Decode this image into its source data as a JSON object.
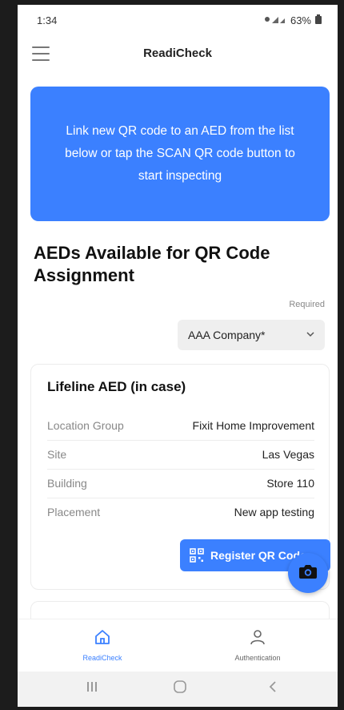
{
  "status_bar": {
    "time": "1:34",
    "battery": "63%"
  },
  "app_bar": {
    "title": "ReadiCheck"
  },
  "banner": {
    "text": "Link new QR code to an AED from the list below or tap the SCAN QR code button to start inspecting"
  },
  "section": {
    "heading": "AEDs Available for QR Code Assignment"
  },
  "company_select": {
    "required_label": "Required",
    "selected": "AAA Company*"
  },
  "aed_card": {
    "title": "Lifeline AED (in case)",
    "rows": [
      {
        "label": "Location Group",
        "value": "Fixit Home Improvement"
      },
      {
        "label": "Site",
        "value": "Las Vegas"
      },
      {
        "label": "Building",
        "value": "Store 110"
      },
      {
        "label": "Placement",
        "value": "New app testing"
      }
    ],
    "register_label": "Register QR Code"
  },
  "bottom_nav": {
    "items": [
      {
        "label": "ReadiCheck",
        "icon": "home-icon",
        "active": true
      },
      {
        "label": "Authentication",
        "icon": "person-icon",
        "active": false
      }
    ]
  },
  "colors": {
    "accent": "#3b80ff"
  }
}
